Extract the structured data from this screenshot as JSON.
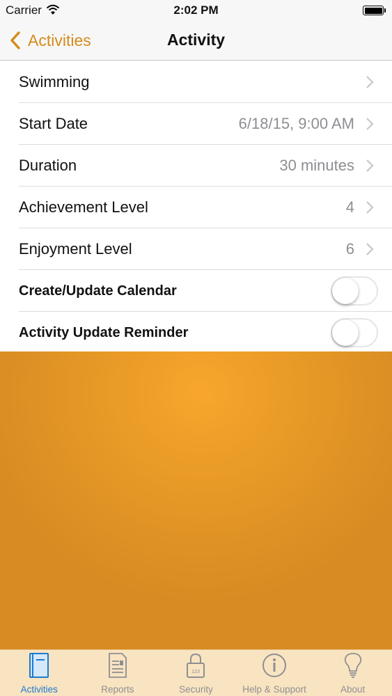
{
  "status_bar": {
    "carrier": "Carrier",
    "time": "2:02 PM"
  },
  "nav": {
    "back_label": "Activities",
    "title": "Activity"
  },
  "rows": [
    {
      "label": "Swimming",
      "value": ""
    },
    {
      "label": "Start Date",
      "value": "6/18/15, 9:00 AM"
    },
    {
      "label": "Duration",
      "value": "30 minutes"
    },
    {
      "label": "Achievement Level",
      "value": "4"
    },
    {
      "label": "Enjoyment Level",
      "value": "6"
    }
  ],
  "toggles": [
    {
      "label": "Create/Update Calendar",
      "on": false
    },
    {
      "label": "Activity Update Reminder",
      "on": false
    }
  ],
  "tabs": [
    {
      "label": "Activities",
      "icon": "notebook-icon",
      "active": true
    },
    {
      "label": "Reports",
      "icon": "report-icon",
      "active": false
    },
    {
      "label": "Security",
      "icon": "lock-icon",
      "active": false
    },
    {
      "label": "Help & Support",
      "icon": "info-icon",
      "active": false
    },
    {
      "label": "About",
      "icon": "lightbulb-icon",
      "active": false
    }
  ],
  "colors": {
    "accent": "#d58b1b",
    "tab_active": "#1b7ad3",
    "tab_bar_bg": "#f9e4c1",
    "content_bg": "#eb9c28"
  }
}
